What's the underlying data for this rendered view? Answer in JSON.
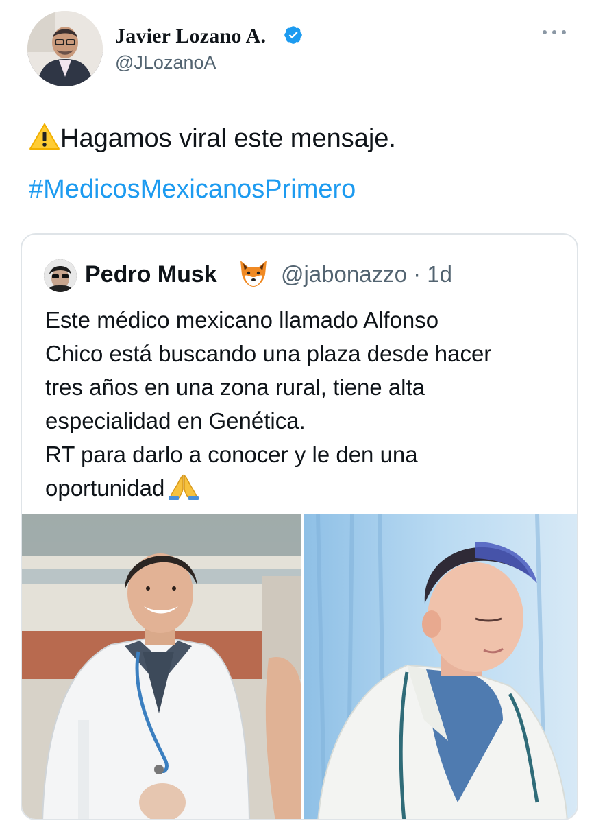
{
  "author": {
    "display_name": "Javier Lozano A.",
    "handle": "@JLozanoA",
    "avatar_icon": "profile-photo",
    "verified_icon": "verified-badge-icon",
    "verified_color": "#1d9bf0"
  },
  "more_icon": "more-options-icon",
  "tweet": {
    "text": "Hagamos viral este mensaje.",
    "emoji_icon": "warning-icon",
    "hashtag": "#MedicosMexicanosPrimero",
    "hashtag_color": "#1d9bf0"
  },
  "quoted": {
    "display_name": "Pedro Musk",
    "name_emoji_icon": "fox-face-icon",
    "handle_time": "@jabonazzo · 1d",
    "lines": [
      "Este médico mexicano llamado Alfonso",
      "Chico está buscando una plaza desde hacer",
      "tres años en una zona rural, tiene alta",
      "especialidad en Genética.",
      "RT para darlo a conocer y le den una",
      "oportunidad"
    ],
    "end_emoji_icon": "folded-hands-icon",
    "photos": [
      "photo-doctor-outdoors",
      "photo-doctor-indoors"
    ]
  }
}
